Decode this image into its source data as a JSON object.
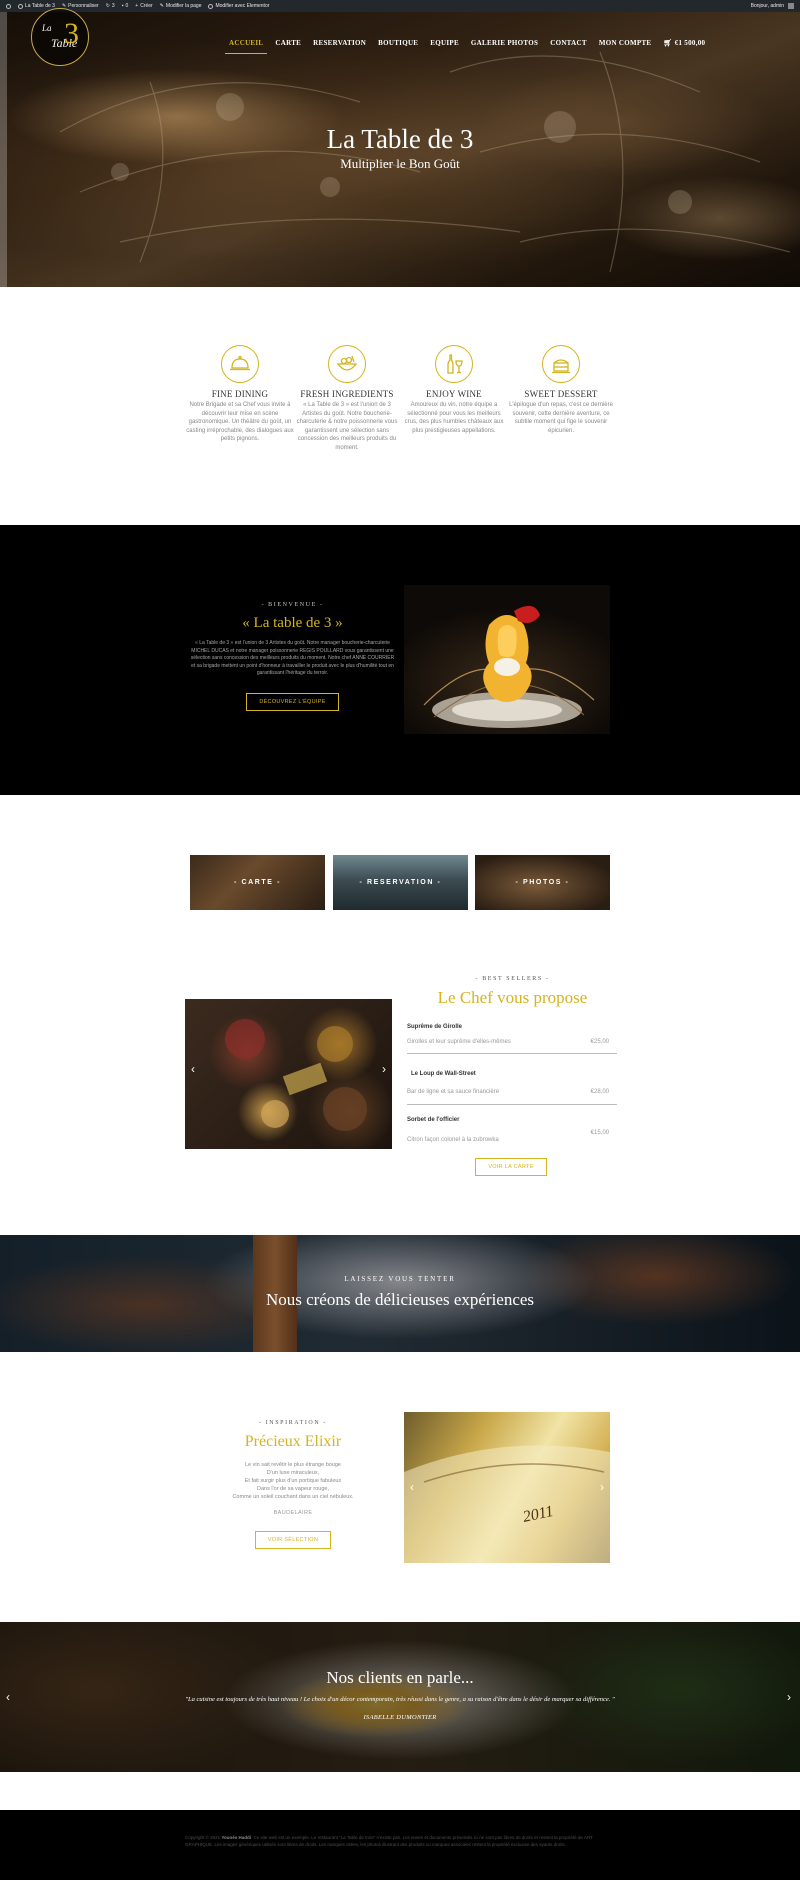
{
  "adminbar": {
    "site": "La Table de 3",
    "customize": "Personnaliser",
    "updates": "3",
    "comments": "0",
    "new": "Créer",
    "edit_page": "Modifier la page",
    "elementor": "Modifier avec Elementor",
    "greeting": "Bonjour, admin"
  },
  "nav": {
    "items": [
      "ACCUEIL",
      "CARTE",
      "RESERVATION",
      "BOUTIQUE",
      "EQUIPE",
      "GALERIE PHOTOS",
      "CONTACT",
      "MON COMPTE"
    ],
    "cart": "€1 500,00"
  },
  "logo": {
    "line1": "La",
    "line2": "Table",
    "number": "3"
  },
  "hero": {
    "title": "La Table de 3",
    "subtitle": "Multiplier le Bon Goût"
  },
  "features": [
    {
      "icon": "cloche-icon",
      "title": "FINE DINING",
      "text": "Notre Brigade et sa Chef vous invite à découvrir leur mise en scène gastronomique. Un théâtre du goût, un casting irréprochable, des dialogues aux petits pignons."
    },
    {
      "icon": "ingredients-icon",
      "title": "FRESH INGREDIENTS",
      "text": "« La Table de 3 » est l'union de 3 Artistes du goût. Notre boucherie-charcuterie & notre poissonnerie vous garantissent une sélection sans concession des meilleurs produits du moment."
    },
    {
      "icon": "wine-icon",
      "title": "ENJOY WINE",
      "text": "Amoureux du vin, notre équipe a sélectionné pour vous les meilleurs crus, des plus humbles châteaux aux plus prestigieuses appellations."
    },
    {
      "icon": "dessert-icon",
      "title": "SWEET DESSERT",
      "text": "L'épilogue d'un repas, c'est ce dernière souvenir, cette dernière aventure, ce subtile moment qui fige le souvenir épicurien."
    }
  ],
  "welcome": {
    "kicker": "- BIENVENUE -",
    "title": "« La table de 3 »",
    "body": "« La Table de 3 » est l'union de 3 Artistes du goût. Notre manager boucherie-charcuterie MICHEL DUCAS et notre manager poissonnerie REGIS POULLARD vous garantissent une sélection sans concession des meilleurs produits du moment. Notre chef ANNE COURRIER et sa brigade mettent un point d'honneur à travailler le produit avec le plus d'humilité tout en garantissant l'héritage du terroir.",
    "button": "DÉCOUVREZ L'ÉQUIPE"
  },
  "tiles": [
    "- CARTE -",
    "- RESERVATION -",
    "- PHOTOS -"
  ],
  "best_sellers": {
    "kicker": "- BEST SELLERS -",
    "title": "Le Chef vous propose",
    "items": [
      {
        "name": "Suprême de Girolle",
        "desc": "Girolles et leur suprême d'elles-mêmes",
        "price": "€25,00"
      },
      {
        "name": "Le Loup de Wall-Street",
        "desc": "Bar de ligne et sa sauce financière",
        "price": "€28,00"
      },
      {
        "name": "Sorbet de l'officier",
        "desc": "Citron façon colonel à la zubrowka",
        "price": "€15,00"
      }
    ],
    "button": "VOIR LA CARTE"
  },
  "banner": {
    "kicker": "LAISSEZ VOUS TENTER",
    "title": "Nous créons de délicieuses expériences"
  },
  "inspiration": {
    "kicker": "- INSPIRATION -",
    "title": "Précieux Elixir",
    "poem": [
      "Le vin sait revêtir le plus étrange bouge",
      "D'un luxe miraculeux,",
      "Et fait surgir plus d'un portique fabuleux",
      "Dans l'or de sa vapeur rouge,",
      "Comme un soleil couchant dans un ciel nébuleux."
    ],
    "author": "BAUDELAIRE",
    "button": "VOIR SÉLECTION",
    "bottle_label": "2011"
  },
  "testimonials": {
    "title": "Nos clients en parle...",
    "quote": "\"La cuisine est toujours de très haut niveau ! Le choix d'un décor contemporain, très réussi dans le genre, a su raison d'être dans le désir de marquer sa différence. \"",
    "name": "ISABELLE DUMONTIER"
  },
  "footer": {
    "prefix": "Copyright © 2021",
    "author": "Younès Haddi",
    "text": ". Ce site web est un exemple. Le restaurant \"La Table de trois\" n'existe pas. Les textes et documents présentés ici ne sont pas libres de droits et restent la propriété de ART GRAPHIQUE. Les images génériques utilisés sont libres de droits. Les marques citées, les photos illustrant des produits ou marques associées restent la propriété exclusive des ayants droits."
  },
  "colors": {
    "accent": "#d4b41f",
    "dark": "#000000",
    "adminbar": "#23282d"
  }
}
